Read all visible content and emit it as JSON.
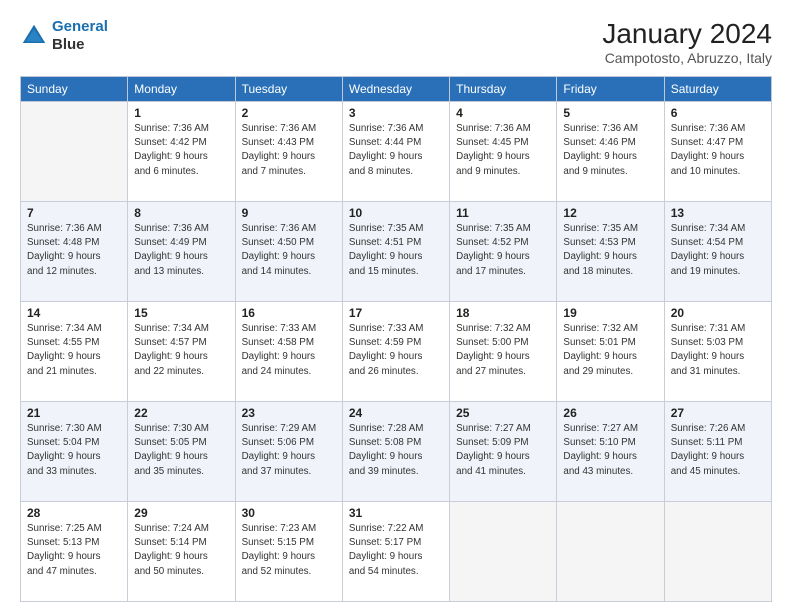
{
  "header": {
    "logo_line1": "General",
    "logo_line2": "Blue",
    "month": "January 2024",
    "location": "Campotosto, Abruzzo, Italy"
  },
  "weekdays": [
    "Sunday",
    "Monday",
    "Tuesday",
    "Wednesday",
    "Thursday",
    "Friday",
    "Saturday"
  ],
  "weeks": [
    [
      {
        "day": "",
        "info": ""
      },
      {
        "day": "1",
        "info": "Sunrise: 7:36 AM\nSunset: 4:42 PM\nDaylight: 9 hours\nand 6 minutes."
      },
      {
        "day": "2",
        "info": "Sunrise: 7:36 AM\nSunset: 4:43 PM\nDaylight: 9 hours\nand 7 minutes."
      },
      {
        "day": "3",
        "info": "Sunrise: 7:36 AM\nSunset: 4:44 PM\nDaylight: 9 hours\nand 8 minutes."
      },
      {
        "day": "4",
        "info": "Sunrise: 7:36 AM\nSunset: 4:45 PM\nDaylight: 9 hours\nand 9 minutes."
      },
      {
        "day": "5",
        "info": "Sunrise: 7:36 AM\nSunset: 4:46 PM\nDaylight: 9 hours\nand 9 minutes."
      },
      {
        "day": "6",
        "info": "Sunrise: 7:36 AM\nSunset: 4:47 PM\nDaylight: 9 hours\nand 10 minutes."
      }
    ],
    [
      {
        "day": "7",
        "info": "Sunrise: 7:36 AM\nSunset: 4:48 PM\nDaylight: 9 hours\nand 12 minutes."
      },
      {
        "day": "8",
        "info": "Sunrise: 7:36 AM\nSunset: 4:49 PM\nDaylight: 9 hours\nand 13 minutes."
      },
      {
        "day": "9",
        "info": "Sunrise: 7:36 AM\nSunset: 4:50 PM\nDaylight: 9 hours\nand 14 minutes."
      },
      {
        "day": "10",
        "info": "Sunrise: 7:35 AM\nSunset: 4:51 PM\nDaylight: 9 hours\nand 15 minutes."
      },
      {
        "day": "11",
        "info": "Sunrise: 7:35 AM\nSunset: 4:52 PM\nDaylight: 9 hours\nand 17 minutes."
      },
      {
        "day": "12",
        "info": "Sunrise: 7:35 AM\nSunset: 4:53 PM\nDaylight: 9 hours\nand 18 minutes."
      },
      {
        "day": "13",
        "info": "Sunrise: 7:34 AM\nSunset: 4:54 PM\nDaylight: 9 hours\nand 19 minutes."
      }
    ],
    [
      {
        "day": "14",
        "info": "Sunrise: 7:34 AM\nSunset: 4:55 PM\nDaylight: 9 hours\nand 21 minutes."
      },
      {
        "day": "15",
        "info": "Sunrise: 7:34 AM\nSunset: 4:57 PM\nDaylight: 9 hours\nand 22 minutes."
      },
      {
        "day": "16",
        "info": "Sunrise: 7:33 AM\nSunset: 4:58 PM\nDaylight: 9 hours\nand 24 minutes."
      },
      {
        "day": "17",
        "info": "Sunrise: 7:33 AM\nSunset: 4:59 PM\nDaylight: 9 hours\nand 26 minutes."
      },
      {
        "day": "18",
        "info": "Sunrise: 7:32 AM\nSunset: 5:00 PM\nDaylight: 9 hours\nand 27 minutes."
      },
      {
        "day": "19",
        "info": "Sunrise: 7:32 AM\nSunset: 5:01 PM\nDaylight: 9 hours\nand 29 minutes."
      },
      {
        "day": "20",
        "info": "Sunrise: 7:31 AM\nSunset: 5:03 PM\nDaylight: 9 hours\nand 31 minutes."
      }
    ],
    [
      {
        "day": "21",
        "info": "Sunrise: 7:30 AM\nSunset: 5:04 PM\nDaylight: 9 hours\nand 33 minutes."
      },
      {
        "day": "22",
        "info": "Sunrise: 7:30 AM\nSunset: 5:05 PM\nDaylight: 9 hours\nand 35 minutes."
      },
      {
        "day": "23",
        "info": "Sunrise: 7:29 AM\nSunset: 5:06 PM\nDaylight: 9 hours\nand 37 minutes."
      },
      {
        "day": "24",
        "info": "Sunrise: 7:28 AM\nSunset: 5:08 PM\nDaylight: 9 hours\nand 39 minutes."
      },
      {
        "day": "25",
        "info": "Sunrise: 7:27 AM\nSunset: 5:09 PM\nDaylight: 9 hours\nand 41 minutes."
      },
      {
        "day": "26",
        "info": "Sunrise: 7:27 AM\nSunset: 5:10 PM\nDaylight: 9 hours\nand 43 minutes."
      },
      {
        "day": "27",
        "info": "Sunrise: 7:26 AM\nSunset: 5:11 PM\nDaylight: 9 hours\nand 45 minutes."
      }
    ],
    [
      {
        "day": "28",
        "info": "Sunrise: 7:25 AM\nSunset: 5:13 PM\nDaylight: 9 hours\nand 47 minutes."
      },
      {
        "day": "29",
        "info": "Sunrise: 7:24 AM\nSunset: 5:14 PM\nDaylight: 9 hours\nand 50 minutes."
      },
      {
        "day": "30",
        "info": "Sunrise: 7:23 AM\nSunset: 5:15 PM\nDaylight: 9 hours\nand 52 minutes."
      },
      {
        "day": "31",
        "info": "Sunrise: 7:22 AM\nSunset: 5:17 PM\nDaylight: 9 hours\nand 54 minutes."
      },
      {
        "day": "",
        "info": ""
      },
      {
        "day": "",
        "info": ""
      },
      {
        "day": "",
        "info": ""
      }
    ]
  ]
}
